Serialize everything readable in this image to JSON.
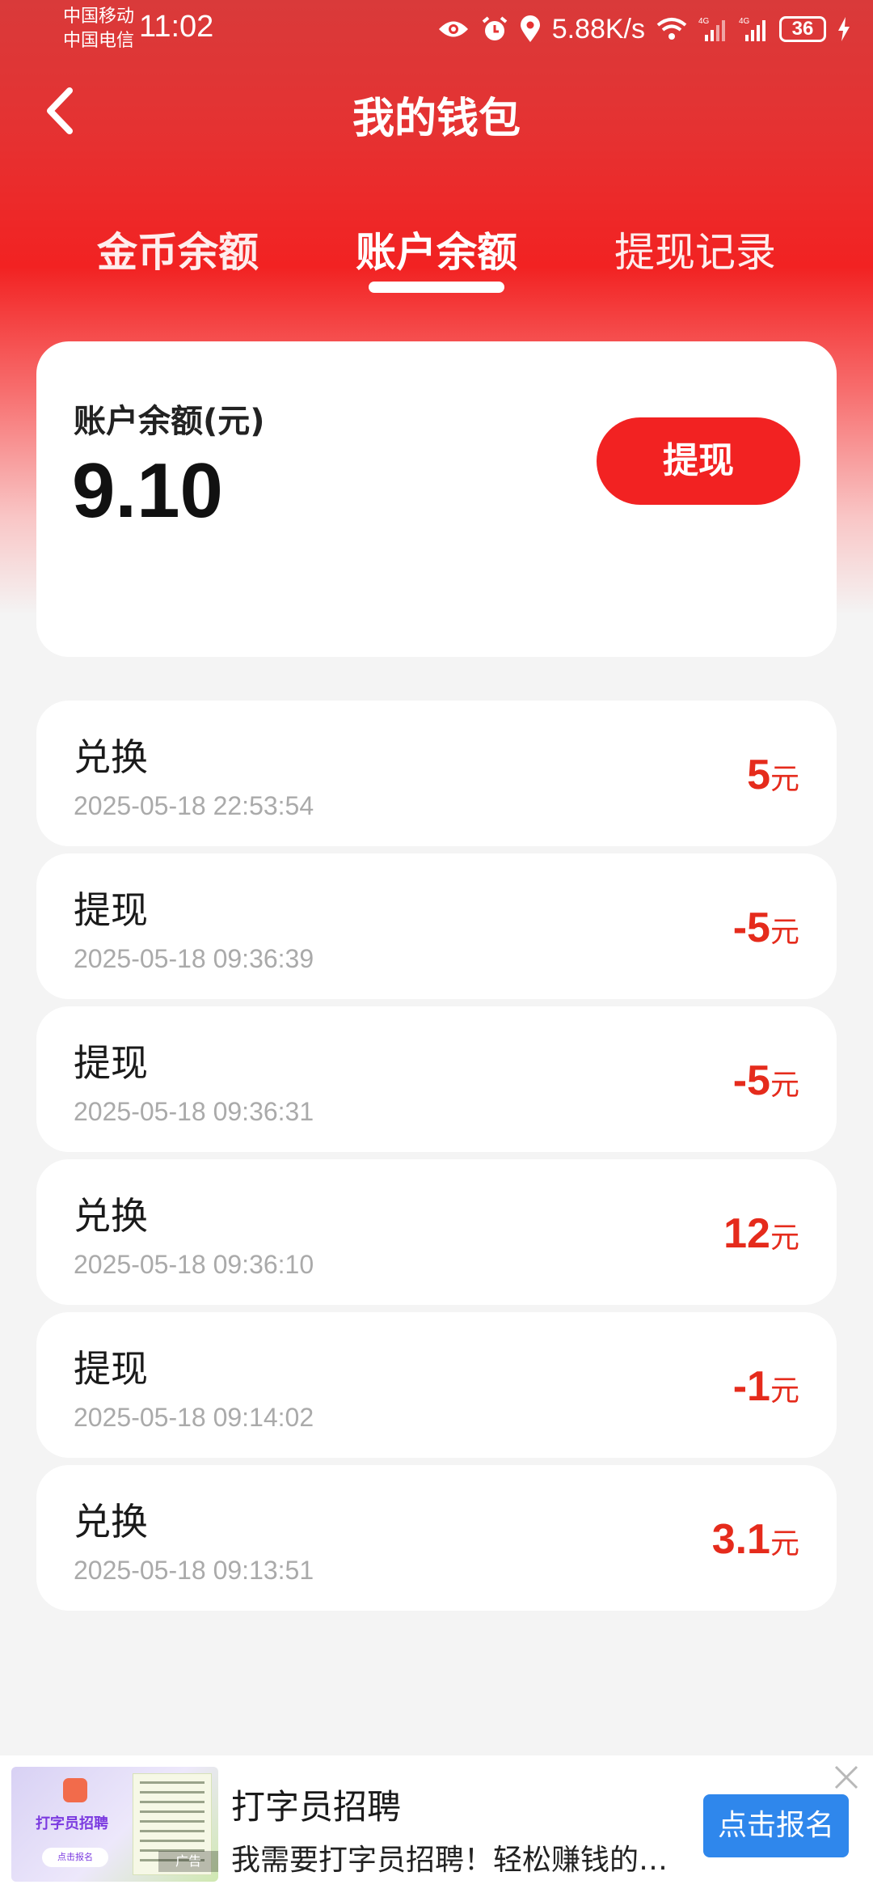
{
  "status_bar": {
    "carrier_1": "中国移动",
    "carrier_2": "中国电信",
    "time": "11:02",
    "net_speed": "5.88K/s",
    "net_type_1": "4G",
    "net_type_2": "4G",
    "battery": "36",
    "icons": [
      "eye-icon",
      "alarm-icon",
      "location-icon",
      "wifi-icon",
      "signal-icon",
      "signal-icon",
      "battery-icon",
      "charging-icon"
    ]
  },
  "header": {
    "title": "我的钱包",
    "back_icon": "chevron-left-icon"
  },
  "tabs": [
    {
      "label": "金币余额",
      "active": false
    },
    {
      "label": "账户余额",
      "active": true
    },
    {
      "label": "提现记录",
      "active": false
    }
  ],
  "balance": {
    "label": "账户余额(元)",
    "value": "9.10",
    "withdraw_label": "提现"
  },
  "records": [
    {
      "type": "兑换",
      "time": "2025-05-18 22:53:54",
      "amount": "5",
      "unit": "元"
    },
    {
      "type": "提现",
      "time": "2025-05-18 09:36:39",
      "amount": "-5",
      "unit": "元"
    },
    {
      "type": "提现",
      "time": "2025-05-18 09:36:31",
      "amount": "-5",
      "unit": "元"
    },
    {
      "type": "兑换",
      "time": "2025-05-18 09:36:10",
      "amount": "12",
      "unit": "元"
    },
    {
      "type": "提现",
      "time": "2025-05-18 09:14:02",
      "amount": "-1",
      "unit": "元"
    },
    {
      "type": "兑换",
      "time": "2025-05-18 09:13:51",
      "amount": "3.1",
      "unit": "元"
    }
  ],
  "ad": {
    "image_text": "打字员招聘",
    "image_button": "点击报名",
    "tag": "广告",
    "title": "打字员招聘",
    "description": "我需要打字员招聘！轻松赚钱的…",
    "cta": "点击报名",
    "close_icon": "close-icon"
  },
  "colors": {
    "header_red": "#e53232",
    "accent_red": "#f22222",
    "amount_red": "#e52b1c",
    "cta_blue": "#2f87ec",
    "background": "#f4f4f4"
  }
}
